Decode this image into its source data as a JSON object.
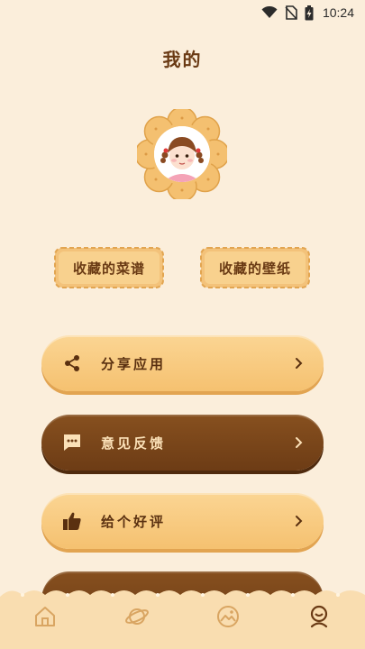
{
  "status_bar": {
    "time": "10:24",
    "icons": [
      "wifi-icon",
      "no-sim-icon",
      "battery-charging-icon"
    ]
  },
  "page": {
    "title": "我的"
  },
  "avatar": {
    "icon": "girl-avatar"
  },
  "favorites": {
    "recipes_label": "收藏的菜谱",
    "wallpapers_label": "收藏的壁纸"
  },
  "menu": {
    "items": [
      {
        "label": "分享应用",
        "icon": "share-icon",
        "style": "light"
      },
      {
        "label": "意见反馈",
        "icon": "feedback-icon",
        "style": "dark"
      },
      {
        "label": "给个好评",
        "icon": "thumbs-up-icon",
        "style": "light"
      }
    ]
  },
  "tab_bar": {
    "items": [
      {
        "name": "home",
        "icon": "home-icon"
      },
      {
        "name": "planet",
        "icon": "planet-icon"
      },
      {
        "name": "image",
        "icon": "image-icon"
      },
      {
        "name": "profile",
        "icon": "profile-icon",
        "active": true
      }
    ]
  },
  "colors": {
    "background": "#fbeedb",
    "cookie_light": "#f5c170",
    "cookie_dark": "#6d3c15",
    "title_brown": "#6a3a14"
  }
}
